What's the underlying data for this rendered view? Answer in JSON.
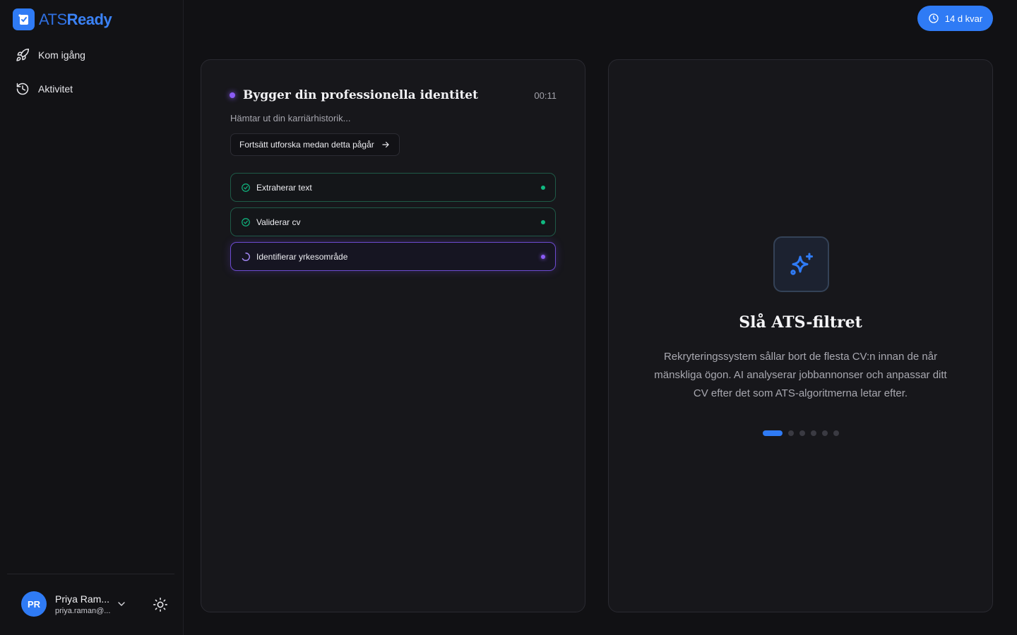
{
  "brand": {
    "part1": "ATS",
    "part2": "Ready",
    "color": "#2f7bf5"
  },
  "sidebar": {
    "items": [
      {
        "label": "Kom igång",
        "icon": "rocket-icon"
      },
      {
        "label": "Aktivitet",
        "icon": "history-icon"
      }
    ]
  },
  "user": {
    "initials": "PR",
    "name": "Priya Ram...",
    "email": "priya.raman@..."
  },
  "trial": {
    "label": "14 d kvar"
  },
  "process": {
    "title": "Bygger din professionella identitet",
    "time": "00:11",
    "subtitle": "Hämtar ut din karriärhistorik...",
    "continue_label": "Fortsätt utforska medan detta pågår",
    "steps": [
      {
        "label": "Extraherar text",
        "status": "done"
      },
      {
        "label": "Validerar cv",
        "status": "done"
      },
      {
        "label": "Identifierar yrkesområde",
        "status": "active"
      }
    ]
  },
  "feature": {
    "title": "Slå ATS-filtret",
    "description": "Rekryteringssystem sållar bort de flesta CV:n innan de når mänskliga ögon. AI analyserar jobbannonser och anpassar ditt CV efter det som ATS-algoritmerna letar efter.",
    "slide_count": 6,
    "active_slide": 1
  },
  "colors": {
    "accent": "#2f7bf5",
    "success": "#10b981",
    "processing": "#8b5cf6"
  }
}
